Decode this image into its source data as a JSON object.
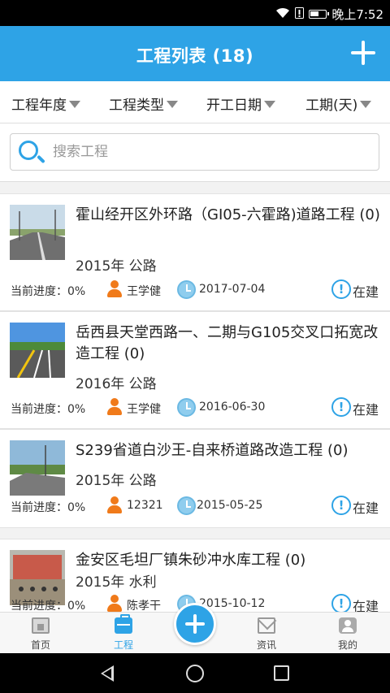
{
  "status_bar": {
    "time": "晚上7:52"
  },
  "header": {
    "title": "工程列表 (18)"
  },
  "filters": [
    {
      "label": "工程年度"
    },
    {
      "label": "工程类型"
    },
    {
      "label": "开工日期"
    },
    {
      "label": "工期(天)"
    }
  ],
  "search": {
    "placeholder": "搜索工程",
    "value": ""
  },
  "projects": [
    {
      "name": "霍山经开区外环路（GI05-六霍路)道路工程 (0)",
      "year_type": "2015年 公路",
      "progress_label": "当前进度：0%",
      "manager": "王学健",
      "date": "2017-07-04",
      "status": "在建"
    },
    {
      "name": "岳西县天堂西路一、二期与G105交叉口拓宽改造工程 (0)",
      "year_type": "2016年 公路",
      "progress_label": "当前进度：0%",
      "manager": "王学健",
      "date": "2016-06-30",
      "status": "在建"
    },
    {
      "name": "S239省道白沙王-自来桥道路改造工程 (0)",
      "year_type": "2015年 公路",
      "progress_label": "当前进度：0%",
      "manager": "12321",
      "date": "2015-05-25",
      "status": "在建"
    },
    {
      "name": "金安区毛坦厂镇朱砂冲水库工程 (0)",
      "year_type": "2015年 水利",
      "progress_label": "当前进度：0%",
      "manager": "陈孝干",
      "date": "2015-10-12",
      "status": "在建"
    }
  ],
  "tabs": [
    {
      "label": "首页",
      "icon": "home-icon"
    },
    {
      "label": "工程",
      "icon": "briefcase-icon",
      "active": true
    },
    {
      "label": "资讯",
      "icon": "mail-icon"
    },
    {
      "label": "我的",
      "icon": "user-icon"
    }
  ],
  "colors": {
    "primary": "#2ea3e6",
    "person": "#f07a1a"
  }
}
